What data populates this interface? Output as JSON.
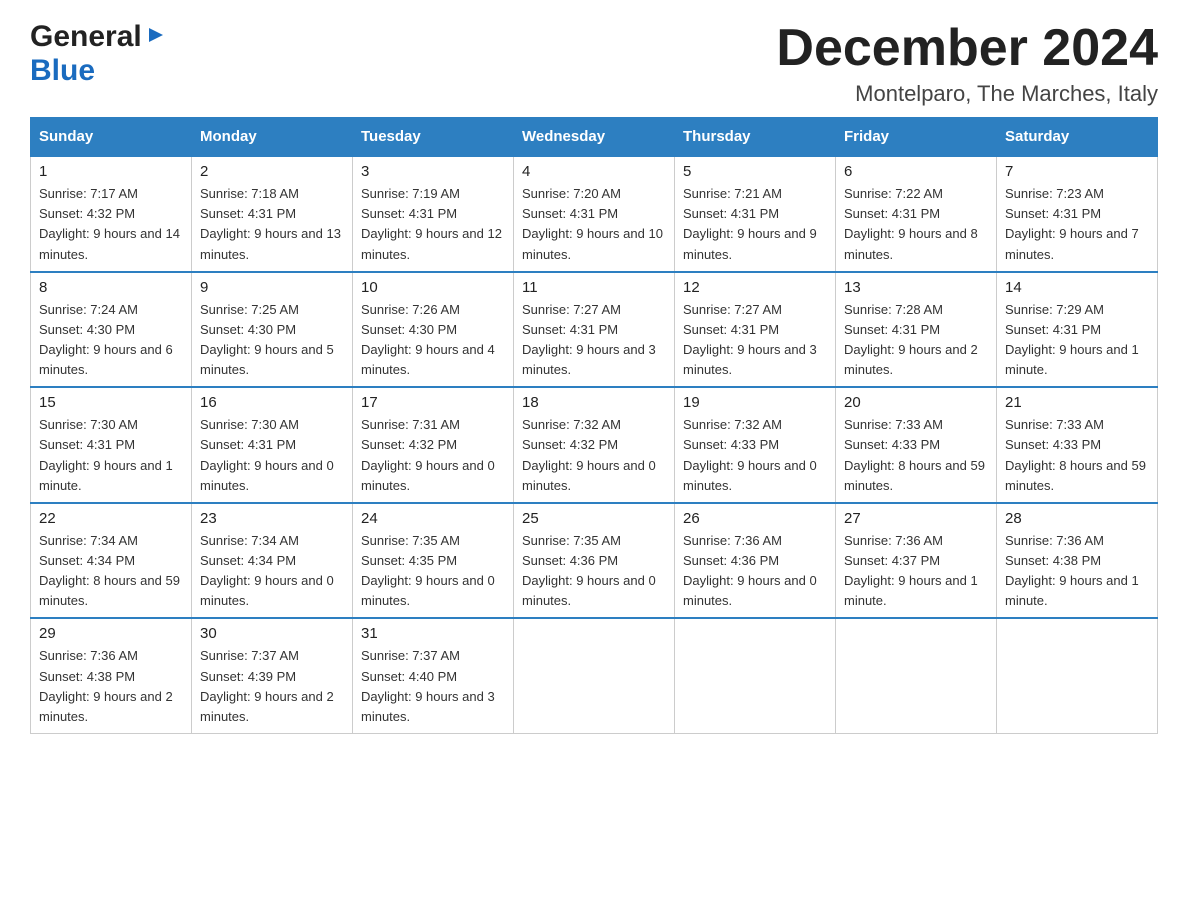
{
  "logo": {
    "general_text": "General",
    "blue_text": "Blue"
  },
  "header": {
    "title": "December 2024",
    "subtitle": "Montelparo, The Marches, Italy"
  },
  "weekdays": [
    "Sunday",
    "Monday",
    "Tuesday",
    "Wednesday",
    "Thursday",
    "Friday",
    "Saturday"
  ],
  "weeks": [
    [
      {
        "day": "1",
        "sunrise": "7:17 AM",
        "sunset": "4:32 PM",
        "daylight": "9 hours and 14 minutes."
      },
      {
        "day": "2",
        "sunrise": "7:18 AM",
        "sunset": "4:31 PM",
        "daylight": "9 hours and 13 minutes."
      },
      {
        "day": "3",
        "sunrise": "7:19 AM",
        "sunset": "4:31 PM",
        "daylight": "9 hours and 12 minutes."
      },
      {
        "day": "4",
        "sunrise": "7:20 AM",
        "sunset": "4:31 PM",
        "daylight": "9 hours and 10 minutes."
      },
      {
        "day": "5",
        "sunrise": "7:21 AM",
        "sunset": "4:31 PM",
        "daylight": "9 hours and 9 minutes."
      },
      {
        "day": "6",
        "sunrise": "7:22 AM",
        "sunset": "4:31 PM",
        "daylight": "9 hours and 8 minutes."
      },
      {
        "day": "7",
        "sunrise": "7:23 AM",
        "sunset": "4:31 PM",
        "daylight": "9 hours and 7 minutes."
      }
    ],
    [
      {
        "day": "8",
        "sunrise": "7:24 AM",
        "sunset": "4:30 PM",
        "daylight": "9 hours and 6 minutes."
      },
      {
        "day": "9",
        "sunrise": "7:25 AM",
        "sunset": "4:30 PM",
        "daylight": "9 hours and 5 minutes."
      },
      {
        "day": "10",
        "sunrise": "7:26 AM",
        "sunset": "4:30 PM",
        "daylight": "9 hours and 4 minutes."
      },
      {
        "day": "11",
        "sunrise": "7:27 AM",
        "sunset": "4:31 PM",
        "daylight": "9 hours and 3 minutes."
      },
      {
        "day": "12",
        "sunrise": "7:27 AM",
        "sunset": "4:31 PM",
        "daylight": "9 hours and 3 minutes."
      },
      {
        "day": "13",
        "sunrise": "7:28 AM",
        "sunset": "4:31 PM",
        "daylight": "9 hours and 2 minutes."
      },
      {
        "day": "14",
        "sunrise": "7:29 AM",
        "sunset": "4:31 PM",
        "daylight": "9 hours and 1 minute."
      }
    ],
    [
      {
        "day": "15",
        "sunrise": "7:30 AM",
        "sunset": "4:31 PM",
        "daylight": "9 hours and 1 minute."
      },
      {
        "day": "16",
        "sunrise": "7:30 AM",
        "sunset": "4:31 PM",
        "daylight": "9 hours and 0 minutes."
      },
      {
        "day": "17",
        "sunrise": "7:31 AM",
        "sunset": "4:32 PM",
        "daylight": "9 hours and 0 minutes."
      },
      {
        "day": "18",
        "sunrise": "7:32 AM",
        "sunset": "4:32 PM",
        "daylight": "9 hours and 0 minutes."
      },
      {
        "day": "19",
        "sunrise": "7:32 AM",
        "sunset": "4:33 PM",
        "daylight": "9 hours and 0 minutes."
      },
      {
        "day": "20",
        "sunrise": "7:33 AM",
        "sunset": "4:33 PM",
        "daylight": "8 hours and 59 minutes."
      },
      {
        "day": "21",
        "sunrise": "7:33 AM",
        "sunset": "4:33 PM",
        "daylight": "8 hours and 59 minutes."
      }
    ],
    [
      {
        "day": "22",
        "sunrise": "7:34 AM",
        "sunset": "4:34 PM",
        "daylight": "8 hours and 59 minutes."
      },
      {
        "day": "23",
        "sunrise": "7:34 AM",
        "sunset": "4:34 PM",
        "daylight": "9 hours and 0 minutes."
      },
      {
        "day": "24",
        "sunrise": "7:35 AM",
        "sunset": "4:35 PM",
        "daylight": "9 hours and 0 minutes."
      },
      {
        "day": "25",
        "sunrise": "7:35 AM",
        "sunset": "4:36 PM",
        "daylight": "9 hours and 0 minutes."
      },
      {
        "day": "26",
        "sunrise": "7:36 AM",
        "sunset": "4:36 PM",
        "daylight": "9 hours and 0 minutes."
      },
      {
        "day": "27",
        "sunrise": "7:36 AM",
        "sunset": "4:37 PM",
        "daylight": "9 hours and 1 minute."
      },
      {
        "day": "28",
        "sunrise": "7:36 AM",
        "sunset": "4:38 PM",
        "daylight": "9 hours and 1 minute."
      }
    ],
    [
      {
        "day": "29",
        "sunrise": "7:36 AM",
        "sunset": "4:38 PM",
        "daylight": "9 hours and 2 minutes."
      },
      {
        "day": "30",
        "sunrise": "7:37 AM",
        "sunset": "4:39 PM",
        "daylight": "9 hours and 2 minutes."
      },
      {
        "day": "31",
        "sunrise": "7:37 AM",
        "sunset": "4:40 PM",
        "daylight": "9 hours and 3 minutes."
      },
      null,
      null,
      null,
      null
    ]
  ],
  "labels": {
    "sunrise": "Sunrise:",
    "sunset": "Sunset:",
    "daylight": "Daylight:"
  }
}
